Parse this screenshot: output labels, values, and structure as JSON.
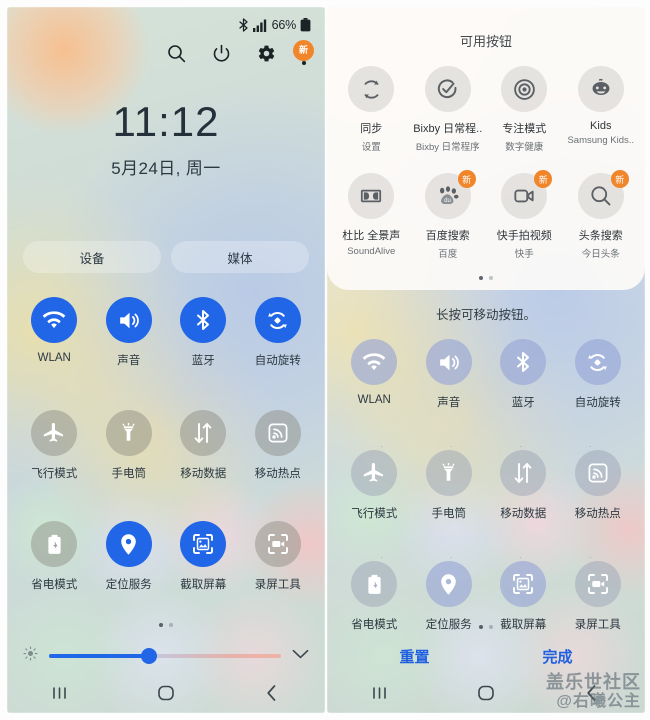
{
  "statusbar": {
    "bluetooth_icon": "bluetooth-icon",
    "signal_icon": "signal-bars-icon",
    "battery_percent": "66%",
    "battery_icon": "battery-icon"
  },
  "quick_actions": {
    "search_icon": "search-icon",
    "power_icon": "power-icon",
    "settings_icon": "gear-icon",
    "more_icon": "more-vertical-icon",
    "more_badge": "新"
  },
  "clock": {
    "time": "11:12",
    "date": "5月24日, 周一"
  },
  "pills": [
    {
      "label": "设备"
    },
    {
      "label": "媒体"
    }
  ],
  "toggles": [
    {
      "label": "WLAN",
      "icon": "wifi-icon",
      "state": "on"
    },
    {
      "label": "声音",
      "icon": "volume-icon",
      "state": "on"
    },
    {
      "label": "蓝牙",
      "icon": "bluetooth-icon",
      "state": "on"
    },
    {
      "label": "自动旋转",
      "icon": "auto-rotate-icon",
      "state": "on"
    },
    {
      "label": "飞行模式",
      "icon": "airplane-icon",
      "state": "off"
    },
    {
      "label": "手电筒",
      "icon": "flashlight-icon",
      "state": "off"
    },
    {
      "label": "移动数据",
      "icon": "mobile-data-icon",
      "state": "off"
    },
    {
      "label": "移动热点",
      "icon": "hotspot-icon",
      "state": "off"
    },
    {
      "label": "省电模式",
      "icon": "power-save-icon",
      "state": "off"
    },
    {
      "label": "定位服务",
      "icon": "location-pin-icon",
      "state": "on"
    },
    {
      "label": "截取屏幕",
      "icon": "screenshot-icon",
      "state": "on"
    },
    {
      "label": "录屏工具",
      "icon": "screen-record-icon",
      "state": "off"
    }
  ],
  "page_dots": {
    "count": 2,
    "active_index": 0
  },
  "brightness": {
    "icon": "brightness-icon",
    "value_percent": 43,
    "expand_icon": "chevron-down-icon"
  },
  "navbar": {
    "recents_icon": "recents-icon",
    "home_icon": "home-icon",
    "back_icon": "back-icon"
  },
  "edit_panel": {
    "card_title": "可用按钮",
    "hint": "长按可移动按钮。",
    "reset_label": "重置",
    "done_label": "完成",
    "available": [
      {
        "name": "同步",
        "sub": "设置",
        "icon": "sync-icon",
        "badge": ""
      },
      {
        "name": "Bixby 日常程..",
        "sub": "Bixby 日常程序",
        "icon": "bixby-routine-icon",
        "badge": ""
      },
      {
        "name": "专注模式",
        "sub": "数字健康",
        "icon": "focus-mode-icon",
        "badge": ""
      },
      {
        "name": "Kids",
        "sub": "Samsung Kids..",
        "icon": "kids-icon",
        "badge": ""
      },
      {
        "name": "杜比 全景声",
        "sub": "SoundAlive",
        "icon": "dolby-icon",
        "badge": ""
      },
      {
        "name": "百度搜索",
        "sub": "百度",
        "icon": "baidu-icon",
        "badge": "新"
      },
      {
        "name": "快手拍视频",
        "sub": "快手",
        "icon": "kuaishou-icon",
        "badge": "新"
      },
      {
        "name": "头条搜索",
        "sub": "今日头条",
        "icon": "toutiao-icon",
        "badge": "新"
      }
    ],
    "card_dots": {
      "count": 2,
      "active_index": 0
    }
  },
  "watermark": {
    "line1": "盖乐世社区",
    "line2": "@右曦公主"
  },
  "colors": {
    "accent_blue": "#2266e8",
    "badge_orange": "#f0852a",
    "edit_link_blue": "#2060e0",
    "text_dark": "#2c3840"
  }
}
